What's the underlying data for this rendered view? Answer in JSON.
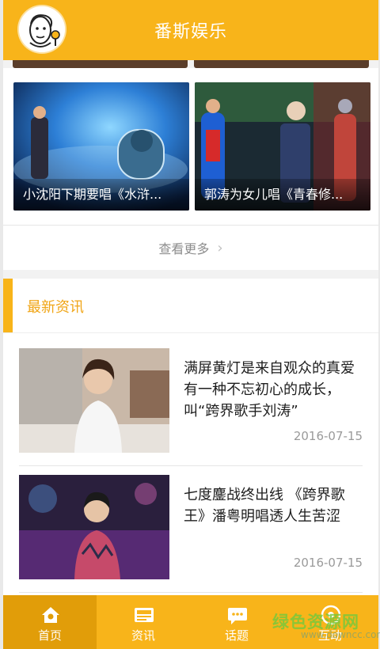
{
  "header": {
    "title": "番斯娱乐"
  },
  "videos": [
    {
      "caption": "小沈阳下期要唱《水浒..."
    },
    {
      "caption": "郭涛为女儿唱《青春修..."
    }
  ],
  "see_more": {
    "label": "查看更多",
    "icon": "chevron-right-icon"
  },
  "news_section": {
    "title": "最新资讯",
    "items": [
      {
        "headline": "满屏黄灯是来自观众的真爱 有一种不忘初心的成长，叫“跨界歌手刘涛”",
        "date": "2016-07-15"
      },
      {
        "headline": "七度鏖战终出线 《跨界歌王》潘粤明唱透人生苦涩",
        "date": "2016-07-15"
      }
    ]
  },
  "tabs": [
    {
      "label": "首页",
      "icon": "home-icon",
      "active": true
    },
    {
      "label": "资讯",
      "icon": "news-icon",
      "active": false
    },
    {
      "label": "话题",
      "icon": "chat-bubble-icon",
      "active": false
    },
    {
      "label": "互动",
      "icon": "interact-icon",
      "active": false
    }
  ],
  "watermark": {
    "text": "绿色资源网",
    "url": "www.downcc.com"
  },
  "colors": {
    "brand": "#f8b41a",
    "brand_dark": "#e19d09",
    "section_title": "#f0a516"
  }
}
